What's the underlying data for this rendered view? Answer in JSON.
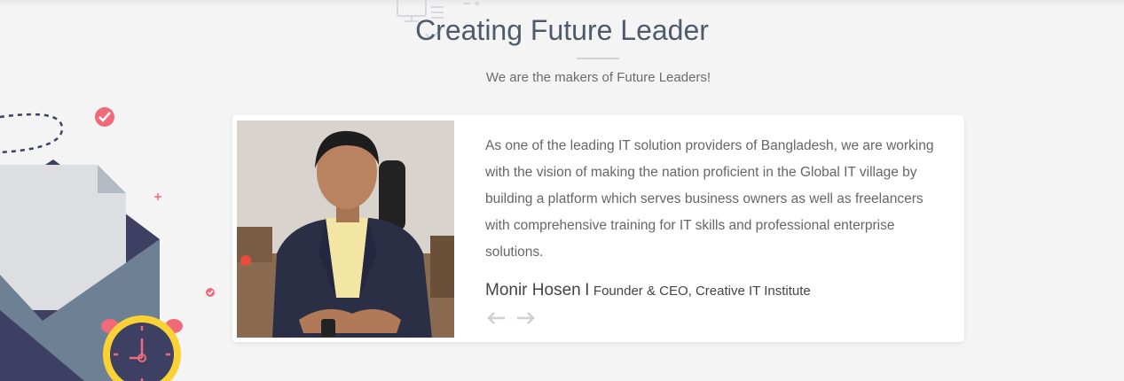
{
  "section": {
    "title": "Creating Future Leader",
    "subtitle": "We are the makers of Future Leaders!"
  },
  "testimonial": {
    "quote": "As one of the leading IT solution providers of Bangladesh, we are working with the vision of making the nation proficient in the Global IT village by building a platform which serves business owners as well as freelancers with comprehensive training for IT skills and professional enterprise solutions.",
    "author_name": "Monir Hosen",
    "separator": "I",
    "author_role": "Founder & CEO, Creative IT Institute"
  },
  "icons": {
    "heading_decoration": "monitor-check-icon",
    "prev": "arrow-left-icon",
    "next": "arrow-right-icon"
  },
  "colors": {
    "title": "#4f5a6b",
    "accent_pink": "#f06a7a",
    "clock_yellow": "#fbd236",
    "envelope_navy": "#3d4062",
    "envelope_slate": "#6e8194"
  }
}
